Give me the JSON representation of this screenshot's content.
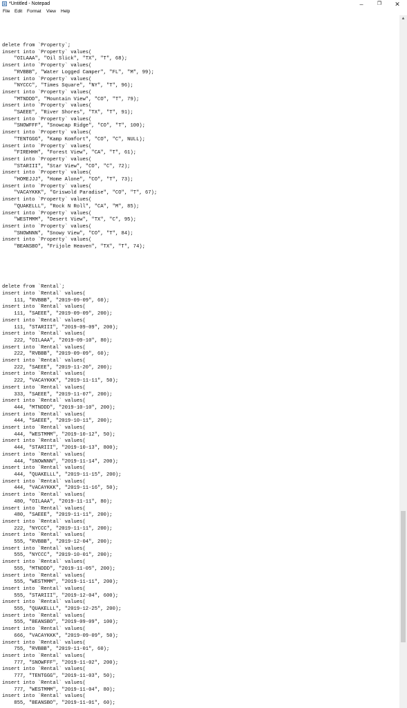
{
  "window": {
    "title": "*Untitled - Notepad",
    "min_glyph": "–",
    "max_glyph": "❐",
    "close_glyph": "✕"
  },
  "menu": {
    "items": [
      "File",
      "Edit",
      "Format",
      "View",
      "Help"
    ]
  },
  "scrollbar": {
    "up_glyph": "▲"
  },
  "editor": {
    "text": "delete from `Property`;\ninsert into `Property` values(\n    \"OILAAA\", \"Oil Slick\", \"TX\", \"T\", 68);\ninsert into `Property` values(\n    \"RVBBB\", \"Water Logged Camper\", \"FL\", \"M\", 99);\ninsert into `Property` values(\n    \"NYCCC\", \"Times Square\", \"NY\", \"T\", 96);\ninsert into `Property` values(\n    \"MTNDDD\", \"Mountain View\", \"CO\", \"T\", 79);\ninsert into `Property` values(\n    \"SAEEE\", \"River Shores\", \"TX\", \"T\", 91);\ninsert into `Property` values(\n    \"SNOWFFF\", \"Snowcap Ridge\", \"CO\", \"T\", 100);\ninsert into `Property` values(\n    \"TENTGGG\", \"Kamp Komfort\", \"CO\", \"C\", NULL);\ninsert into `Property` values(\n    \"FIREHHH\", \"Forest View\", \"CA\", \"T\", 61);\ninsert into `Property` values(\n    \"STARIII\", \"Star View\", \"CO\", \"C\", 72);\ninsert into `Property` values(\n    \"HOMEJJJ\", \"Home Alone\", \"CO\", \"T\", 73);\ninsert into `Property` values(\n    \"VACAYKKK\", \"Griswold Paradise\", \"CO\", \"T\", 67);\ninsert into `Property` values(\n    \"QUAKELLL\", \"Rock N Roll\", \"CA\", \"M\", 85);\ninsert into `Property` values(\n    \"WESTMMM\", \"Desert View\", \"TX\", \"C\", 95);\ninsert into `Property` values(\n    \"SNOWNNN\", \"Snowy View\", \"CO\", \"T\", 84);\ninsert into `Property` values(\n    \"BEANSBO\", \"Frijole Heaven\", \"TX\", \"T\", 74);\n\n\n\n\n\ndelete from `Rental`;\ninsert into `Rental` values(\n    111, \"RVBBB\", \"2019-09-09\", 60);\ninsert into `Rental` values(\n    111, \"SAEEE\", \"2019-09-09\", 200);\ninsert into `Rental` values(\n    111, \"STARIII\", \"2019-09-09\", 200);\ninsert into `Rental` values(\n    222, \"OILAAA\", \"2019-09-10\", 80);\ninsert into `Rental` values(\n    222, \"RVBBB\", \"2019-09-09\", 60);\ninsert into `Rental` values(\n    222, \"SAEEE\", \"2019-11-20\", 200);\ninsert into `Rental` values(\n    222, \"VACAYKKK\", \"2019-11-11\", 50);\ninsert into `Rental` values(\n    333, \"SAEEE\", \"2019-11-07\", 200);\ninsert into `Rental` values(\n    444, \"MTNDDD\", \"2019-10-10\", 200);\ninsert into `Rental` values(\n    444, \"SAEEE\", \"2019-10-11\", 200);\ninsert into `Rental` values(\n    444, \"WESTMMM\", \"2019-10-12\", 50);\ninsert into `Rental` values(\n    444, \"STARIII\", \"2019-10-13\", 800);\ninsert into `Rental` values(\n    444, \"SNOWNNN\", \"2019-11-14\", 200);\ninsert into `Rental` values(\n    444, \"QUAKELLL\", \"2019-11-15\", 200);\ninsert into `Rental` values(\n    444, \"VACAYKKK\", \"2019-11-16\", 50);\ninsert into `Rental` values(\n    480, \"OILAAA\", \"2019-11-11\", 80);\ninsert into `Rental` values(\n    480, \"SAEEE\", \"2019-11-11\", 200);\ninsert into `Rental` values(\n    222, \"NYCCC\", \"2019-11-11\", 200);\ninsert into `Rental` values(\n    555, \"RVBBB\", \"2019-12-04\", 200);\ninsert into `Rental` values(\n    555, \"NYCCC\", \"2019-10-01\", 200);\ninsert into `Rental` values(\n    555, \"MTNDDD\", \"2019-11-05\", 200);\ninsert into `Rental` values(\n    555, \"WESTMMM\", \"2019-11-11\", 200);\ninsert into `Rental` values(\n    555, \"STARIII\", \"2019-12-04\", 600);\ninsert into `Rental` values(\n    555, \"QUAKELLL\", \"2019-12-25\", 200);\ninsert into `Rental` values(\n    555, \"BEANSBO\", \"2019-09-09\", 100);\ninsert into `Rental` values(\n    666, \"VACAYKKK\", \"2019-09-09\", 50);\ninsert into `Rental` values(\n    755, \"RVBBB\", \"2019-11-01\", 60);\ninsert into `Rental` values(\n    777, \"SNOWFFF\", \"2019-11-02\", 200);\ninsert into `Rental` values(\n    777, \"TENTGGG\", \"2019-11-03\", 50);\ninsert into `Rental` values(\n    777, \"WESTMMM\", \"2019-11-04\", 80);\ninsert into `Rental` values(\n    855, \"BEANSBO\", \"2019-11-01\", 60);"
  }
}
